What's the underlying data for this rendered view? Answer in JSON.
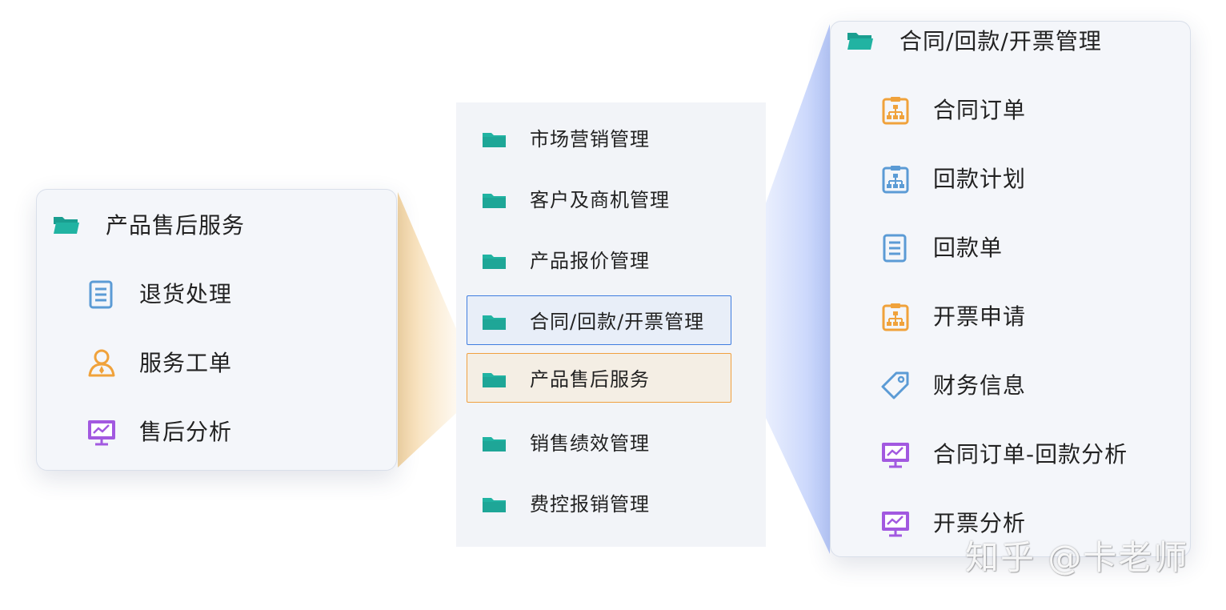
{
  "colors": {
    "folder": "#21b3a2",
    "selected_blue_border": "#3f7ce0",
    "selected_orange_border": "#f0a040",
    "icon_orange": "#f0a23b",
    "icon_blue": "#5b9bd5",
    "icon_purple": "#a259e0"
  },
  "center_menu": {
    "items": [
      {
        "label": "市场营销管理",
        "icon": "folder-icon"
      },
      {
        "label": "客户及商机管理",
        "icon": "folder-icon"
      },
      {
        "label": "产品报价管理",
        "icon": "folder-icon"
      },
      {
        "label": "合同/回款/开票管理",
        "icon": "folder-icon",
        "selected": "blue"
      },
      {
        "label": "产品售后服务",
        "icon": "folder-icon",
        "selected": "orange"
      },
      {
        "label": "销售绩效管理",
        "icon": "folder-icon"
      },
      {
        "label": "费控报销管理",
        "icon": "folder-icon"
      }
    ]
  },
  "left_panel": {
    "title": "产品售后服务",
    "items": [
      {
        "label": "退货处理",
        "icon": "document-icon"
      },
      {
        "label": "服务工单",
        "icon": "service-person-icon"
      },
      {
        "label": "售后分析",
        "icon": "chart-monitor-icon"
      }
    ]
  },
  "right_panel": {
    "title": "合同/回款/开票管理",
    "items": [
      {
        "label": "合同订单",
        "icon": "clipboard-org-icon"
      },
      {
        "label": "回款计划",
        "icon": "clipboard-org-icon"
      },
      {
        "label": "回款单",
        "icon": "document-icon"
      },
      {
        "label": "开票申请",
        "icon": "clipboard-org-icon"
      },
      {
        "label": "财务信息",
        "icon": "tag-icon"
      },
      {
        "label": "合同订单-回款分析",
        "icon": "chart-monitor-icon"
      },
      {
        "label": "开票分析",
        "icon": "chart-monitor-icon"
      }
    ]
  },
  "watermark": "知乎 @卡老师"
}
